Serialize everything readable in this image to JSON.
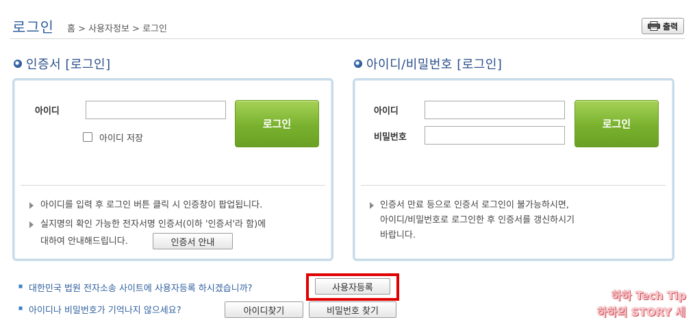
{
  "header": {
    "title": "로그인",
    "breadcrumb": "홈 > 사용자정보 > 로그인",
    "print_label": "출력"
  },
  "cert_login": {
    "title": "인증서 [로그인]",
    "id_label": "아이디",
    "id_value": "",
    "login_button": "로그인",
    "save_id_label": "아이디 저장",
    "save_id_checked": false,
    "notes": [
      "아이디를 입력 후 로그인 버튼 클릭 시 인증창이 팝업됩니다.",
      "실지명의 확인 가능한 전자서명 인증서(이하 '인증서'라 함)에",
      "대하여 안내해드립니다."
    ],
    "guide_button": "인증서 안내"
  },
  "id_login": {
    "title": "아이디/비밀번호 [로그인]",
    "id_label": "아이디",
    "pw_label": "비밀번호",
    "id_value": "",
    "pw_value": "",
    "login_button": "로그인",
    "notes": [
      "인증서 만료 등으로 인증서 로그인이 불가능하시면,",
      "아이디/비밀번호로 로그인한 후 인증서를 갱신하시기",
      "바랍니다."
    ]
  },
  "bottom": {
    "register_text": "대한민국 법원 전자소송 사이트에 사용자등록 하시겠습니까?",
    "register_button": "사용자등록",
    "forgot_text": "아이디나 비밀번호가 기억나지 않으세요?",
    "find_id_button": "아이디찾기",
    "find_pw_button": "비밀번호 찾기"
  },
  "watermark": {
    "line1": "하하 Tech Tip",
    "line2": "하하의 STORY 세상"
  },
  "colors": {
    "accent": "#2f5f9e",
    "login_green": "#79b12e",
    "highlight": "#e00000"
  }
}
